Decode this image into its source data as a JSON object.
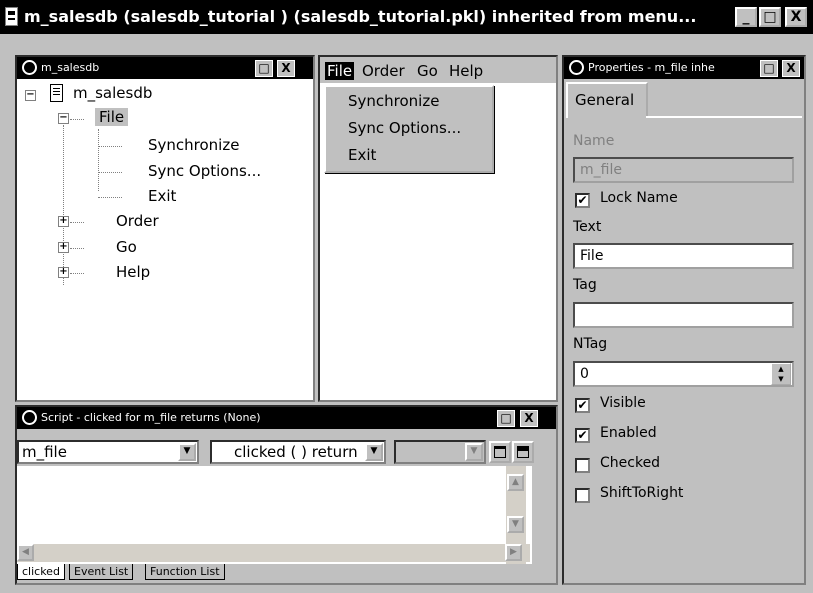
{
  "window": {
    "title": "m_salesdb (salesdb_tutorial ) (salesdb_tutorial.pkl) inherited from menu...",
    "btn_minimize": "_",
    "btn_maximize": "□",
    "btn_close": "X"
  },
  "tree_pane": {
    "title": "m_salesdb",
    "root_label": "m_salesdb",
    "items": [
      {
        "label": "File",
        "expanded": true,
        "selected": true,
        "children": [
          "Synchronize",
          "Sync Options...",
          "Exit"
        ]
      },
      {
        "label": "Order",
        "expanded": false
      },
      {
        "label": "Go",
        "expanded": false
      },
      {
        "label": "Help",
        "expanded": false
      }
    ],
    "expand_symbol": "+",
    "collapse_symbol": "−"
  },
  "preview_pane": {
    "menubar": [
      "File",
      "Order",
      "Go",
      "Help"
    ],
    "dropdown": [
      "Synchronize",
      "Sync Options...",
      "Exit"
    ]
  },
  "properties_pane": {
    "title": "Properties - m_file inhe",
    "tab_general": "General",
    "name_label": "Name",
    "name_value": "m_file",
    "lock_name_label": "Lock Name",
    "lock_name_checked": true,
    "text_label": "Text",
    "text_value": "File",
    "tag_label": "Tag",
    "tag_value": "",
    "ntag_label": "NTag",
    "ntag_value": "0",
    "visible_label": "Visible",
    "visible_checked": true,
    "enabled_label": "Enabled",
    "enabled_checked": true,
    "checked_label": "Checked",
    "checked_checked": false,
    "shift_label": "ShiftToRight",
    "shift_checked": false
  },
  "script_pane": {
    "title": "Script - clicked for m_file returns (None)",
    "object_dropdown": "m_file",
    "event_dropdown": "clicked ( ) return",
    "third_dropdown": "",
    "tabs": [
      "clicked",
      "Event List",
      "Function List"
    ]
  },
  "glyphs": {
    "check": "✔",
    "down_arrow": "▼",
    "up_arrow": "▲",
    "left_arrow": "◀",
    "right_arrow": "▶"
  }
}
